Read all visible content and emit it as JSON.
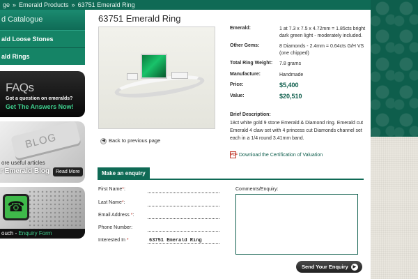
{
  "breadcrumb": {
    "items": [
      "ge",
      "Emerald Products",
      "63751 Emerald Ring"
    ],
    "separator": "»"
  },
  "sidebar": {
    "catalogue_heading": "d Catalogue",
    "items": [
      {
        "label": "ald Loose Stones"
      },
      {
        "label": "ald Rings"
      }
    ]
  },
  "faq_banner": {
    "title": "FAQs",
    "question": "Got a question on emeralds?",
    "cta": "Get The Answers Now!"
  },
  "blog_banner": {
    "key_text": "BLOG",
    "line1": "ore useful articles",
    "line2": "r Emerald Blog",
    "read_more": "Read More"
  },
  "contact_banner": {
    "prefix": "ouch - ",
    "link": "Enquiry Form"
  },
  "product": {
    "title": "63751 Emerald Ring",
    "back_link": "Back to previous page",
    "specs": [
      {
        "label": "Emerald:",
        "value": "1 at 7.3 x 7.5 x 4.72mm = 1.85cts bright dark green light - moderately included.",
        "highlight": false
      },
      {
        "label": "Other Gems:",
        "value": "8 Diamonds - 2.4mm = 0.64cts G/H VS (one chipped)",
        "highlight": false
      },
      {
        "label": "Total Ring Weight:",
        "value": "7.8 grams",
        "highlight": false
      },
      {
        "label": "Manufacture:",
        "value": "Handmade",
        "highlight": false
      },
      {
        "label": "Price:",
        "value": "$5,400",
        "highlight": true
      },
      {
        "label": "Value:",
        "value": "$20,510",
        "highlight": true
      }
    ],
    "description_heading": "Brief Description:",
    "description": "18ct white gold 9 stone Emerald & Diamond ring. Emerald cut Emerald 4 claw set with 4 princess cut Diamonds channel set each in a 1/4 round 3.41mm band.",
    "certificate_link": "Download the Certification of Valuation",
    "certificate_icon": "pdf-icon"
  },
  "enquiry": {
    "heading": "Make an enquiry",
    "fields": [
      {
        "label": "First Name",
        "required": "*",
        "value": ""
      },
      {
        "label": "Last Name",
        "required": "*",
        "value": ""
      },
      {
        "label": "Email Address",
        "required": "*",
        "value": ""
      },
      {
        "label": "Phone Number",
        "required": "",
        "value": ""
      },
      {
        "label": "Interested In",
        "required": "*",
        "value": "63751 Emerald Ring"
      }
    ],
    "comments_label": "Comments/Enquiry:",
    "submit_label": "Send Your Enquiry"
  },
  "colors": {
    "brand_green": "#0f6a55",
    "price_green": "#0e5e4c",
    "required_red": "#c0392b"
  }
}
